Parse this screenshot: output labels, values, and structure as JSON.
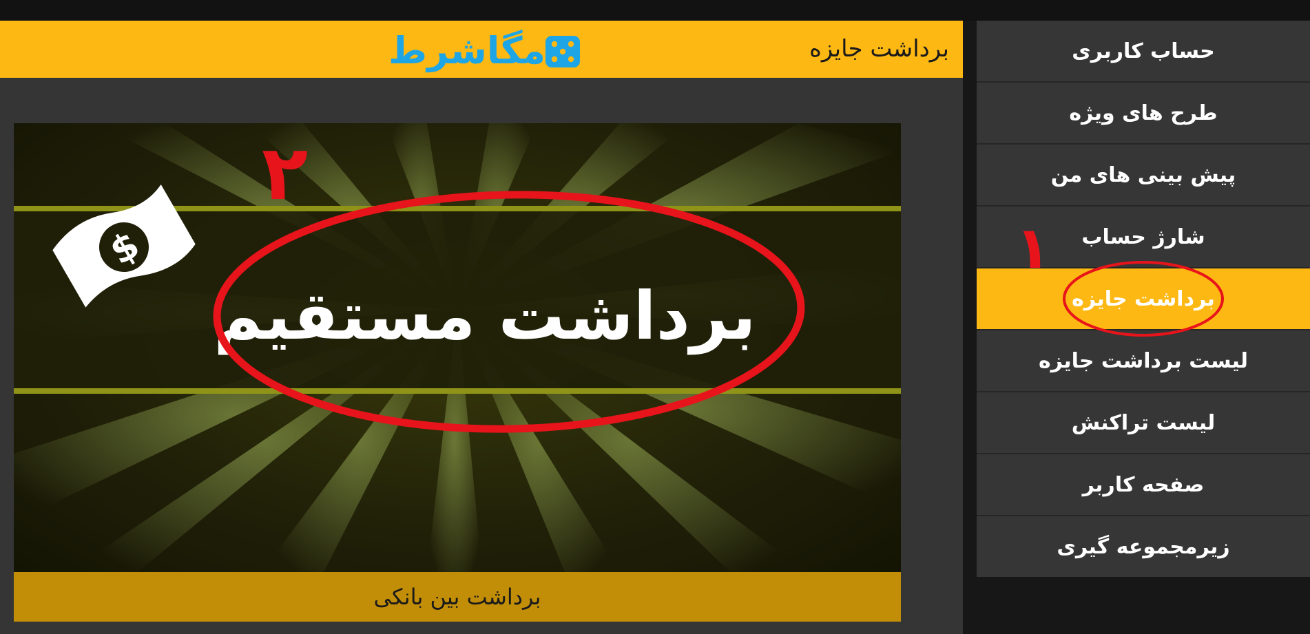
{
  "header": {
    "title": "برداشت جایزه",
    "logo_text": "مگاشرط"
  },
  "banner": {
    "title": "برداشت مستقیم",
    "icon": "dollar-bill-icon",
    "caption": "برداشت بین بانکی"
  },
  "sidebar": {
    "items": [
      {
        "label": "حساب کاربری",
        "active": false
      },
      {
        "label": "طرح های ویژه",
        "active": false
      },
      {
        "label": "پیش بینی های من",
        "active": false
      },
      {
        "label": "شارژ حساب",
        "active": false
      },
      {
        "label": "برداشت جایزه",
        "active": true
      },
      {
        "label": "لیست برداشت جایزه",
        "active": false
      },
      {
        "label": "لیست تراکنش",
        "active": false
      },
      {
        "label": "صفحه کاربر",
        "active": false
      },
      {
        "label": "زیرمجموعه گیری",
        "active": false
      }
    ]
  },
  "annotations": {
    "step1": "۱",
    "step2": "۲"
  },
  "colors": {
    "accent": "#FDB813",
    "caption_bg": "#C38E07",
    "panel_bg": "#353535",
    "annotation_red": "#E8141B",
    "logo_blue": "#1EA5E6"
  }
}
